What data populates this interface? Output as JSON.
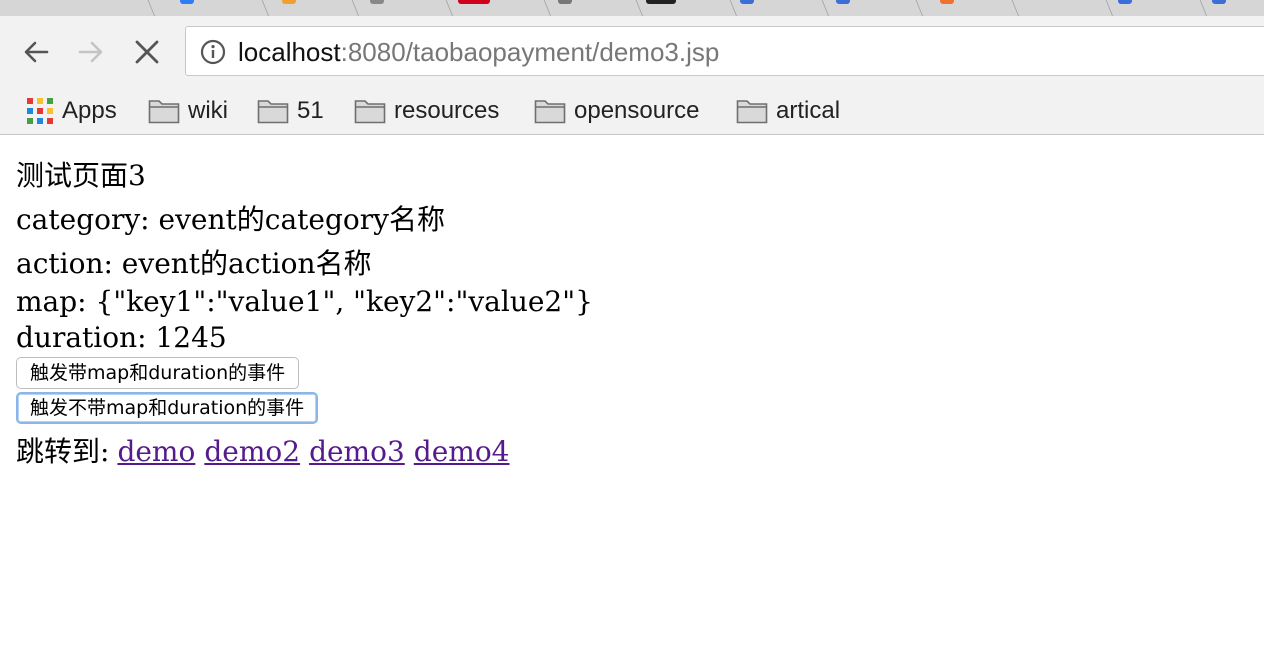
{
  "browser": {
    "url_host": "localhost",
    "url_rest": ":8080/taobaopayment/demo3.jsp",
    "bookmarks": [
      {
        "label": "Apps",
        "icon": "apps-grid-icon"
      },
      {
        "label": "wiki",
        "icon": "folder-icon"
      },
      {
        "label": "51",
        "icon": "folder-icon"
      },
      {
        "label": "resources",
        "icon": "folder-icon"
      },
      {
        "label": "opensource",
        "icon": "folder-icon"
      },
      {
        "label": "artical",
        "icon": "folder-icon"
      }
    ],
    "nav_icons": {
      "back": "back-arrow-icon",
      "forward": "forward-arrow-icon",
      "stop": "stop-x-icon",
      "site_info": "info-icon"
    }
  },
  "page": {
    "title": "测试页面3",
    "category_line": "category: event的category名称",
    "action_line": "action: event的action名称",
    "map_line": "map: {\"key1\":\"value1\", \"key2\":\"value2\"}",
    "duration_line": "duration: 1245",
    "button_with": "触发带map和duration的事件",
    "button_without": "触发不带map和duration的事件",
    "jump_label": "跳转到:",
    "links": [
      "demo",
      "demo2",
      "demo3",
      "demo4"
    ]
  },
  "colors": {
    "link_visited": "#551a8b",
    "focus_ring": "#8db6e8",
    "chrome_bg": "#f2f2f2"
  }
}
